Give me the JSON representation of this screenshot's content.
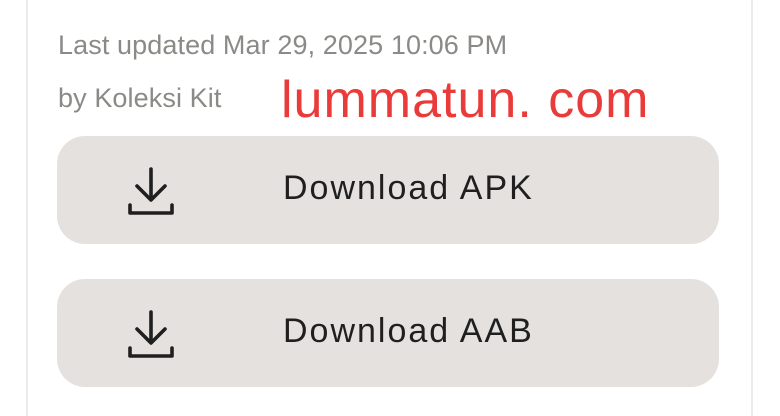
{
  "meta": {
    "last_updated": "Last updated Mar 29, 2025 10:06 PM",
    "author": "by Koleksi Kit"
  },
  "watermark": {
    "text": "lummatun. com",
    "color": "#ea3b3b"
  },
  "downloads": [
    {
      "label": "Download APK",
      "icon": "download-icon"
    },
    {
      "label": "Download AAB",
      "icon": "download-icon"
    }
  ],
  "colors": {
    "button_bg": "#e5e1de",
    "meta_text": "#8c8a87",
    "label_text": "#1f1f1f"
  }
}
